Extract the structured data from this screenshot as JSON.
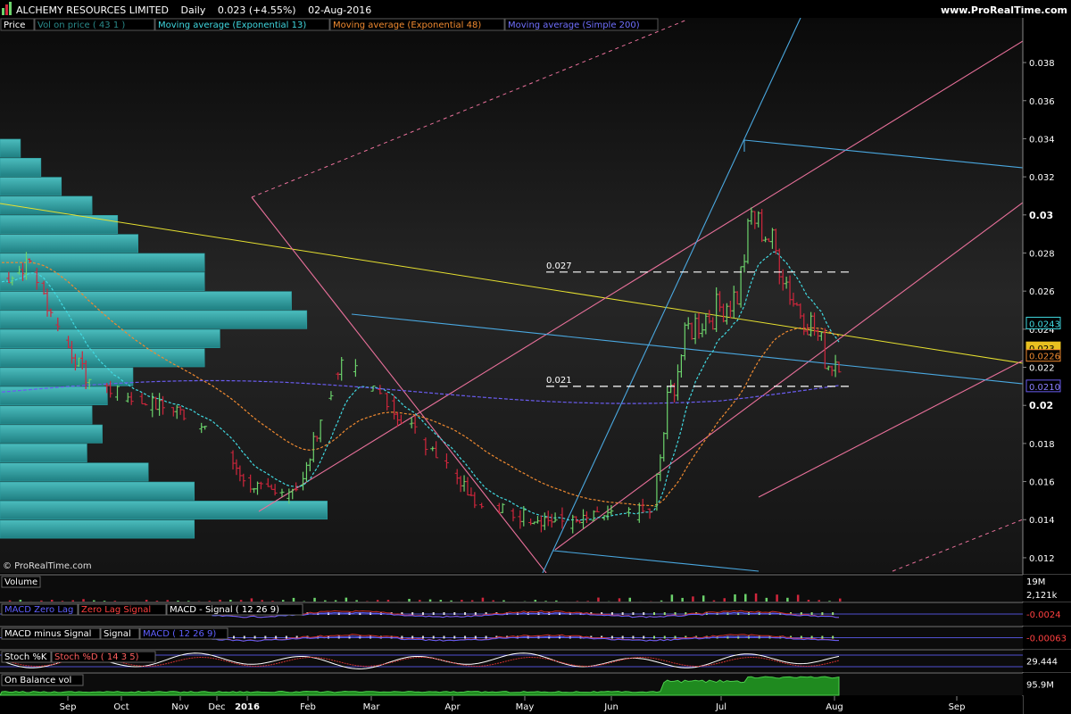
{
  "header": {
    "instrument": "ALCHEMY RESOURCES LIMITED",
    "period": "Daily",
    "quote": "0.023 (+4.55%)",
    "date": "02-Aug-2016",
    "site": "www.ProRealTime.com"
  },
  "copyright": "© ProRealTime.com",
  "legend": [
    {
      "label": "Price",
      "color": "#ffffff"
    },
    {
      "label": "Vol on price ( 43 1 )",
      "color": "#2a8a8a"
    },
    {
      "label": "Moving average (Exponential 13)",
      "color": "#40d8e0"
    },
    {
      "label": "Moving average (Exponential 48)",
      "color": "#f08a30"
    },
    {
      "label": "Moving average (Simple 200)",
      "color": "#7070ff"
    }
  ],
  "colors": {
    "background": "#000000",
    "up_bar": "#6cd36c",
    "down_bar": "#d0263c",
    "volume_profile": "#36a9ab",
    "ema13": "#40d8e0",
    "ema48": "#f08a30",
    "sma200": "#6a5cf0",
    "trendline_yellow": "#e6e030",
    "channel_pink": "#e8709a",
    "channel_blue": "#4aa8e0"
  },
  "chart_data": {
    "type": "ohlc",
    "x_axis_months": [
      "Sep",
      "Oct",
      "Nov",
      "Dec",
      "2016",
      "Feb",
      "Mar",
      "Apr",
      "May",
      "Jun",
      "Jul",
      "Aug",
      "Sep"
    ],
    "y_ticks": [
      "0.012",
      "0.014",
      "0.016",
      "0.018",
      "0.02",
      "0.022",
      "0.024",
      "0.026",
      "0.028",
      "0.03",
      "0.032",
      "0.034",
      "0.036",
      "0.038"
    ],
    "ylim": [
      0.0112,
      0.0403
    ],
    "price_labels": [
      {
        "text": "0.0243",
        "value": 0.0243,
        "bg": "#000000",
        "fg": "#40d8e0",
        "border": "#40d8e0"
      },
      {
        "text": "0.023",
        "value": 0.023,
        "bg": "#e8c020",
        "fg": "#000000",
        "border": "#e8c020"
      },
      {
        "text": "0.0226",
        "value": 0.0226,
        "bg": "#000000",
        "fg": "#f08a30",
        "border": "#f08a30"
      },
      {
        "text": "0.0210",
        "value": 0.021,
        "bg": "#000000",
        "fg": "#8a80ff",
        "border": "#6a5cf0"
      }
    ],
    "horizontal_levels": [
      {
        "label": "0.027",
        "value": 0.027
      },
      {
        "label": "0.021",
        "value": 0.021
      }
    ],
    "volume_profile": [
      {
        "price": 0.0335,
        "width": 0.02
      },
      {
        "price": 0.0325,
        "width": 0.04
      },
      {
        "price": 0.0315,
        "width": 0.06
      },
      {
        "price": 0.0305,
        "width": 0.09
      },
      {
        "price": 0.0295,
        "width": 0.115
      },
      {
        "price": 0.0285,
        "width": 0.135
      },
      {
        "price": 0.0275,
        "width": 0.2
      },
      {
        "price": 0.0265,
        "width": 0.2
      },
      {
        "price": 0.0255,
        "width": 0.285
      },
      {
        "price": 0.0245,
        "width": 0.3
      },
      {
        "price": 0.0235,
        "width": 0.215
      },
      {
        "price": 0.0225,
        "width": 0.2
      },
      {
        "price": 0.0215,
        "width": 0.13
      },
      {
        "price": 0.0205,
        "width": 0.105
      },
      {
        "price": 0.0195,
        "width": 0.09
      },
      {
        "price": 0.0185,
        "width": 0.1
      },
      {
        "price": 0.0175,
        "width": 0.085
      },
      {
        "price": 0.0165,
        "width": 0.145
      },
      {
        "price": 0.0155,
        "width": 0.19
      },
      {
        "price": 0.0145,
        "width": 0.32
      },
      {
        "price": 0.0135,
        "width": 0.19
      }
    ],
    "series": [
      {
        "name": "Moving average (Exponential 13)",
        "color": "#40d8e0"
      },
      {
        "name": "Moving average (Exponential 48)",
        "color": "#f08a30"
      },
      {
        "name": "Moving average (Simple 200)",
        "color": "#6a5cf0"
      }
    ]
  },
  "panels": [
    {
      "id": "volume",
      "title": "Volume",
      "values": [
        "19M",
        "2,121k"
      ],
      "value_fg": "#ffffff"
    },
    {
      "id": "macd_zero",
      "title": "MACD Zero Lag",
      "title2": "Zero Lag Signal",
      "title3": "MACD - Signal ( 12 26 9)",
      "values": [
        "-0.0024"
      ],
      "value_fg": "#ff4040"
    },
    {
      "id": "macd_hist",
      "title": "MACD minus Signal",
      "title2": "Signal",
      "title3": "MACD ( 12 26 9)",
      "values": [
        "-0.00063"
      ],
      "value_fg": "#ff4040"
    },
    {
      "id": "stoch",
      "title": "Stoch %K",
      "title2": "Stoch %D ( 14 3 5)",
      "values": [
        "29.444"
      ],
      "value_fg": "#ffffff"
    },
    {
      "id": "obv",
      "title": "On Balance vol",
      "values": [
        "95.9M"
      ],
      "value_fg": "#ffffff"
    }
  ]
}
